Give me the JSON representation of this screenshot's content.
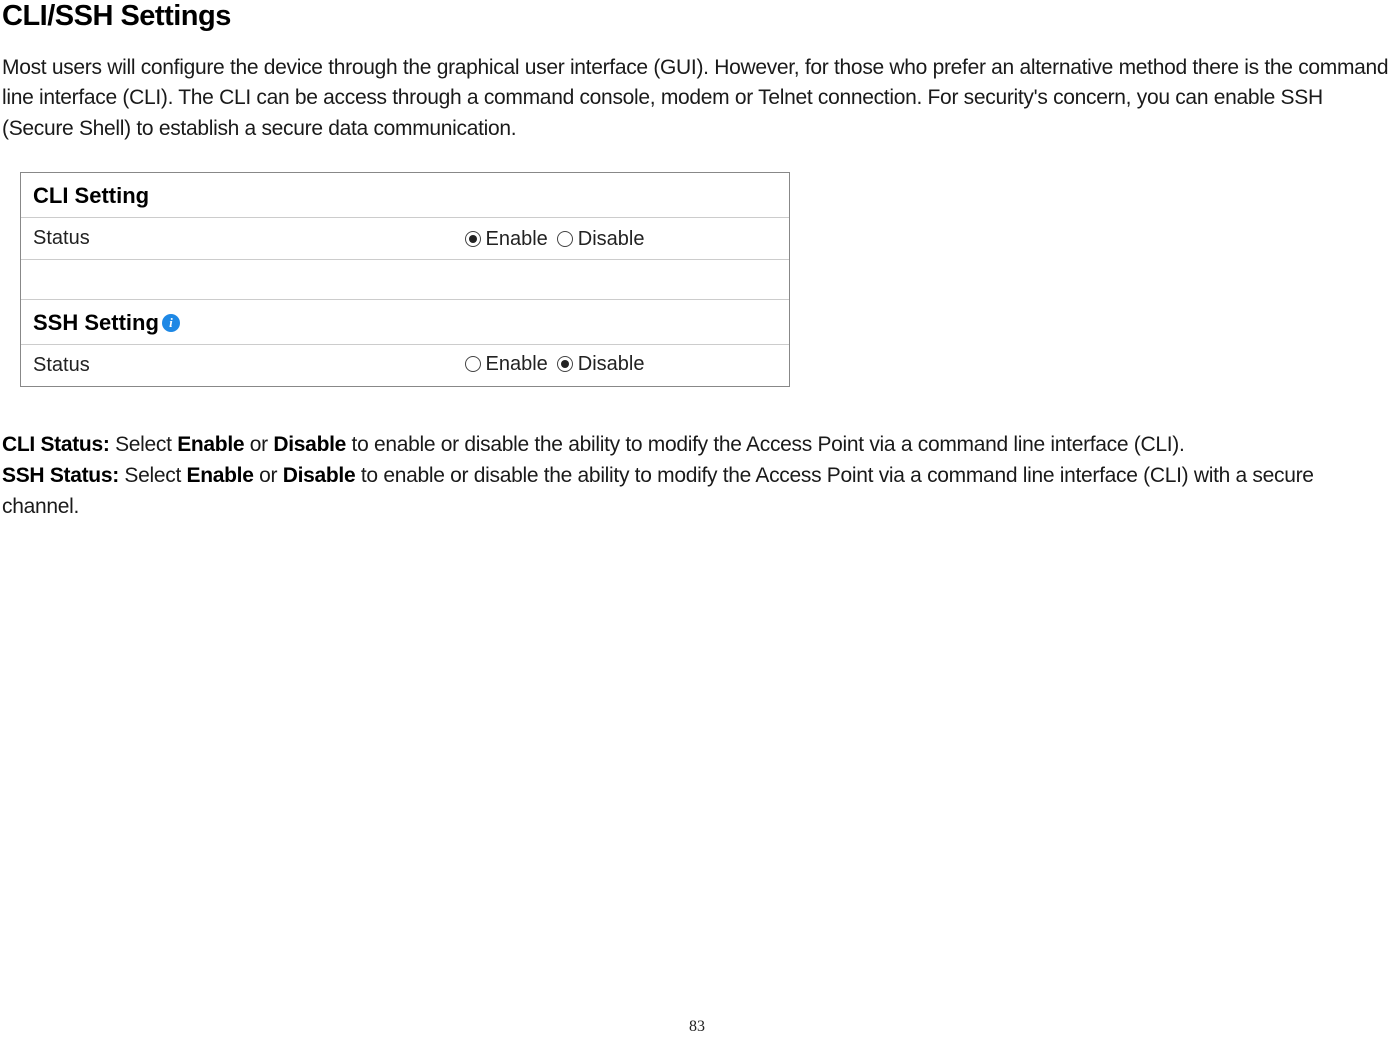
{
  "heading": "CLI/SSH Settings",
  "intro": "Most users will configure the device through the graphical user interface (GUI). However, for those who prefer an alternative method there is the command line interface (CLI). The CLI can be access through a command console, modem or Telnet connection. For security's concern, you can enable SSH (Secure Shell) to establish a secure data communication.",
  "panel": {
    "cli": {
      "title": "CLI Setting",
      "row_label": "Status",
      "enable": "Enable",
      "disable": "Disable",
      "selected": "enable"
    },
    "ssh": {
      "title": "SSH Setting",
      "row_label": "Status",
      "enable": "Enable",
      "disable": "Disable",
      "selected": "disable"
    }
  },
  "desc": {
    "cli_label": "CLI Status:",
    "cli_part1": " Select ",
    "cli_b1": "Enable",
    "cli_mid": " or ",
    "cli_b2": "Disable",
    "cli_rest": " to enable or disable the ability to modify the Access Point via a command line interface (CLI).",
    "ssh_label": "SSH Status:",
    "ssh_part1": " Select ",
    "ssh_b1": "Enable",
    "ssh_mid": " or ",
    "ssh_b2": "Disable",
    "ssh_rest": " to enable or disable the ability to modify the Access Point via a command line interface (CLI) with a secure channel."
  },
  "page_number": "83"
}
